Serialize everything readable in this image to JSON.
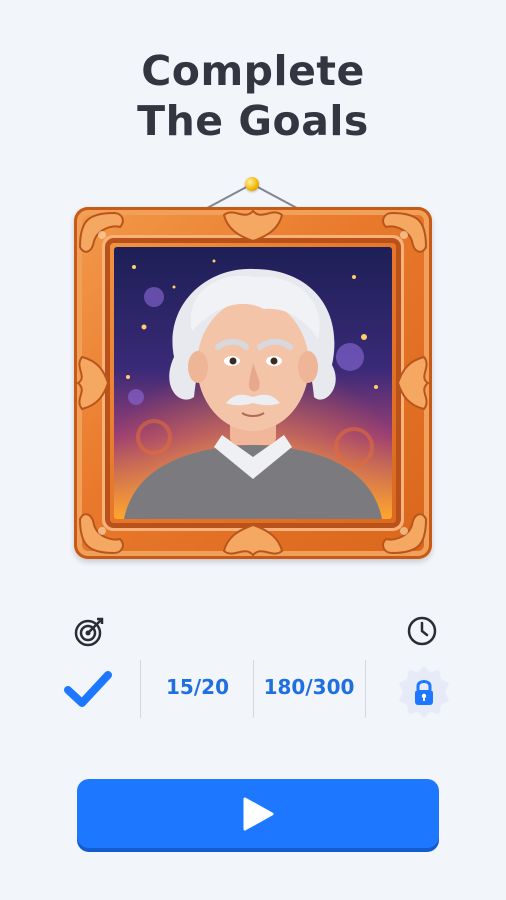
{
  "title": {
    "line1": "Complete",
    "line2": "The Goals"
  },
  "portrait": {
    "subject": "einstein-cartoon-portrait"
  },
  "goals": {
    "target_icon": "target-icon",
    "timer_icon": "clock-icon",
    "check_icon": "checkmark-icon",
    "lock_icon": "lock-icon",
    "moves_value": "15/20",
    "score_value": "180/300"
  },
  "colors": {
    "accent": "#1e78ff",
    "value_text": "#1f6fe0",
    "frame": "#e8782b",
    "title": "#333641"
  },
  "play_button": {
    "icon": "play-icon"
  }
}
